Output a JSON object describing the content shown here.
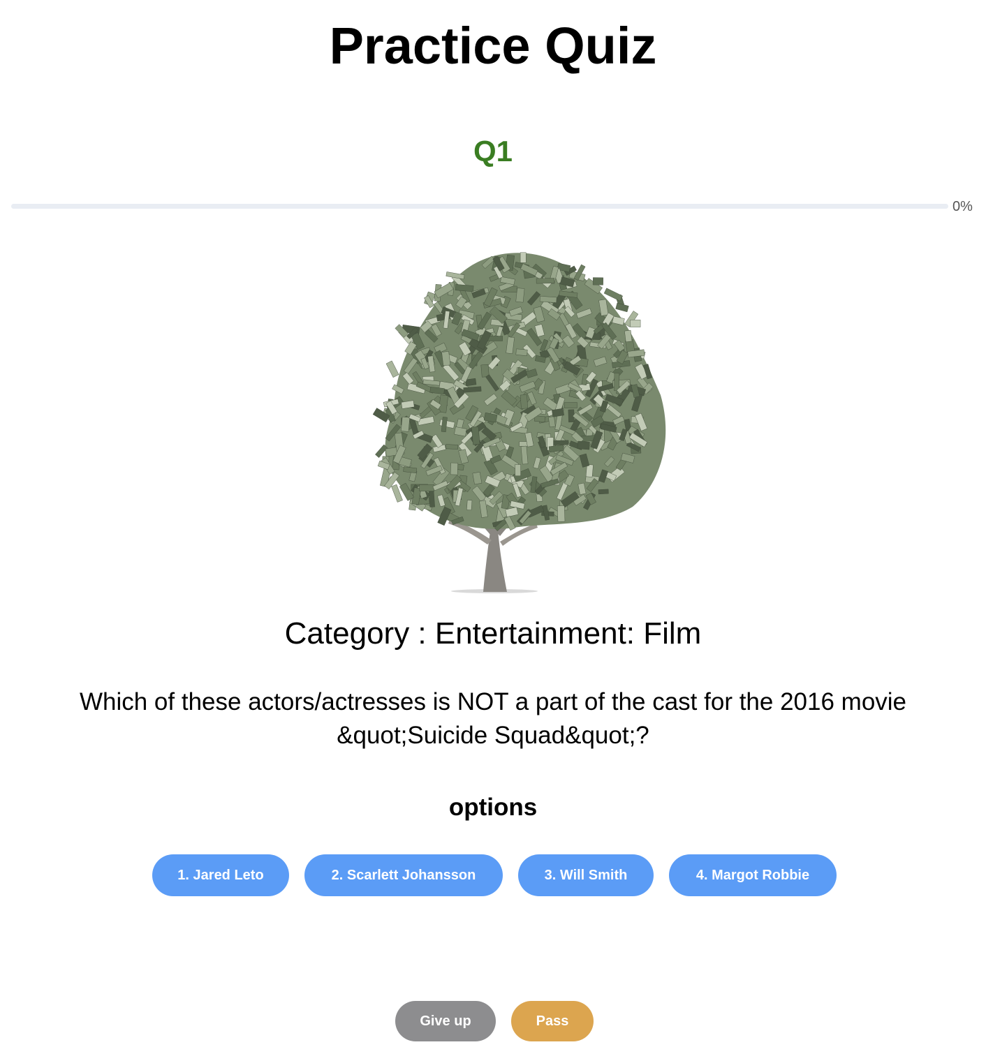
{
  "header": {
    "title": "Practice Quiz"
  },
  "question": {
    "number_label": "Q1",
    "progress_percent": 0,
    "progress_label": "0%",
    "category_label": "Category : Entertainment: Film",
    "text": "Which of these actors/actresses is NOT a part of the cast for the 2016 movie &quot;Suicide Squad&quot;?",
    "illustration_icon": "money-tree"
  },
  "options": {
    "heading": "options",
    "items": [
      {
        "label": "1. Jared Leto"
      },
      {
        "label": "2. Scarlett Johansson"
      },
      {
        "label": "3. Will Smith"
      },
      {
        "label": "4. Margot Robbie"
      }
    ]
  },
  "actions": {
    "give_up_label": "Give up",
    "pass_label": "Pass"
  },
  "colors": {
    "question_number": "#3a7d22",
    "option_button": "#5b9cf6",
    "give_up_button": "#8d8d8f",
    "pass_button": "#dca54f",
    "progress_track": "#e9edf3",
    "progress_fill": "#5b9cf6"
  }
}
